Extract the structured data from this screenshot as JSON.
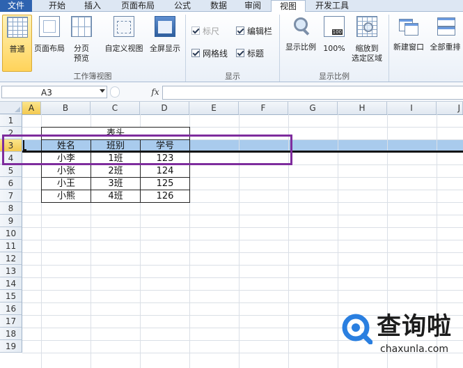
{
  "tabs": [
    {
      "label": "文件",
      "active": false
    },
    {
      "label": "开始",
      "active": false
    },
    {
      "label": "插入",
      "active": false
    },
    {
      "label": "页面布局",
      "active": false
    },
    {
      "label": "公式",
      "active": false
    },
    {
      "label": "数据",
      "active": false
    },
    {
      "label": "审阅",
      "active": false
    },
    {
      "label": "视图",
      "active": true
    },
    {
      "label": "开发工具",
      "active": false
    }
  ],
  "ribbon": {
    "workbook_views": {
      "label": "工作簿视图",
      "normal": "普通",
      "page_layout": "页面布局",
      "page_break_line1": "分页",
      "page_break_line2": "预览",
      "custom_views": "自定义视图",
      "full_screen": "全屏显示"
    },
    "show": {
      "label": "显示",
      "ruler": "标尺",
      "formula_bar": "编辑栏",
      "gridlines": "网格线",
      "headings": "标题",
      "ruler_checked": true,
      "formula_bar_checked": true,
      "gridlines_checked": true,
      "headings_checked": true
    },
    "zoom": {
      "label": "显示比例",
      "zoom": "显示比例",
      "hundred": "100%",
      "hundred_icon_text": "100",
      "zoom_to_selection_line1": "缩放到",
      "zoom_to_selection_line2": "选定区域"
    },
    "window": {
      "new_window": "新建窗口",
      "arrange_all": "全部重排"
    }
  },
  "formula_bar": {
    "name_box": "A3",
    "fx_label": "fx",
    "formula": ""
  },
  "sheet": {
    "columns": [
      "A",
      "B",
      "C",
      "D",
      "E",
      "F",
      "G",
      "H",
      "I",
      "J"
    ],
    "rows": [
      "1",
      "2",
      "3",
      "4",
      "5",
      "6",
      "7",
      "8",
      "9",
      "10",
      "11",
      "12",
      "13",
      "14",
      "15",
      "16",
      "17",
      "18",
      "19"
    ],
    "selected_row": "3",
    "active_cell": "A3",
    "table_title": "表头",
    "headers": [
      "姓名",
      "班别",
      "学号"
    ],
    "records": [
      [
        "小李",
        "1班",
        "123"
      ],
      [
        "小张",
        "2班",
        "124"
      ],
      [
        "小王",
        "3班",
        "125"
      ],
      [
        "小熊",
        "4班",
        "126"
      ]
    ]
  },
  "watermark": {
    "name": "查询啦",
    "domain": "chaxunla.com",
    "accent": "#2a7fe0"
  },
  "colors": {
    "file_tab": "#2e63b0",
    "selection_band": "#a9cbed",
    "selected_header": "#f3c950",
    "highlight_box": "#7e2c9d"
  }
}
